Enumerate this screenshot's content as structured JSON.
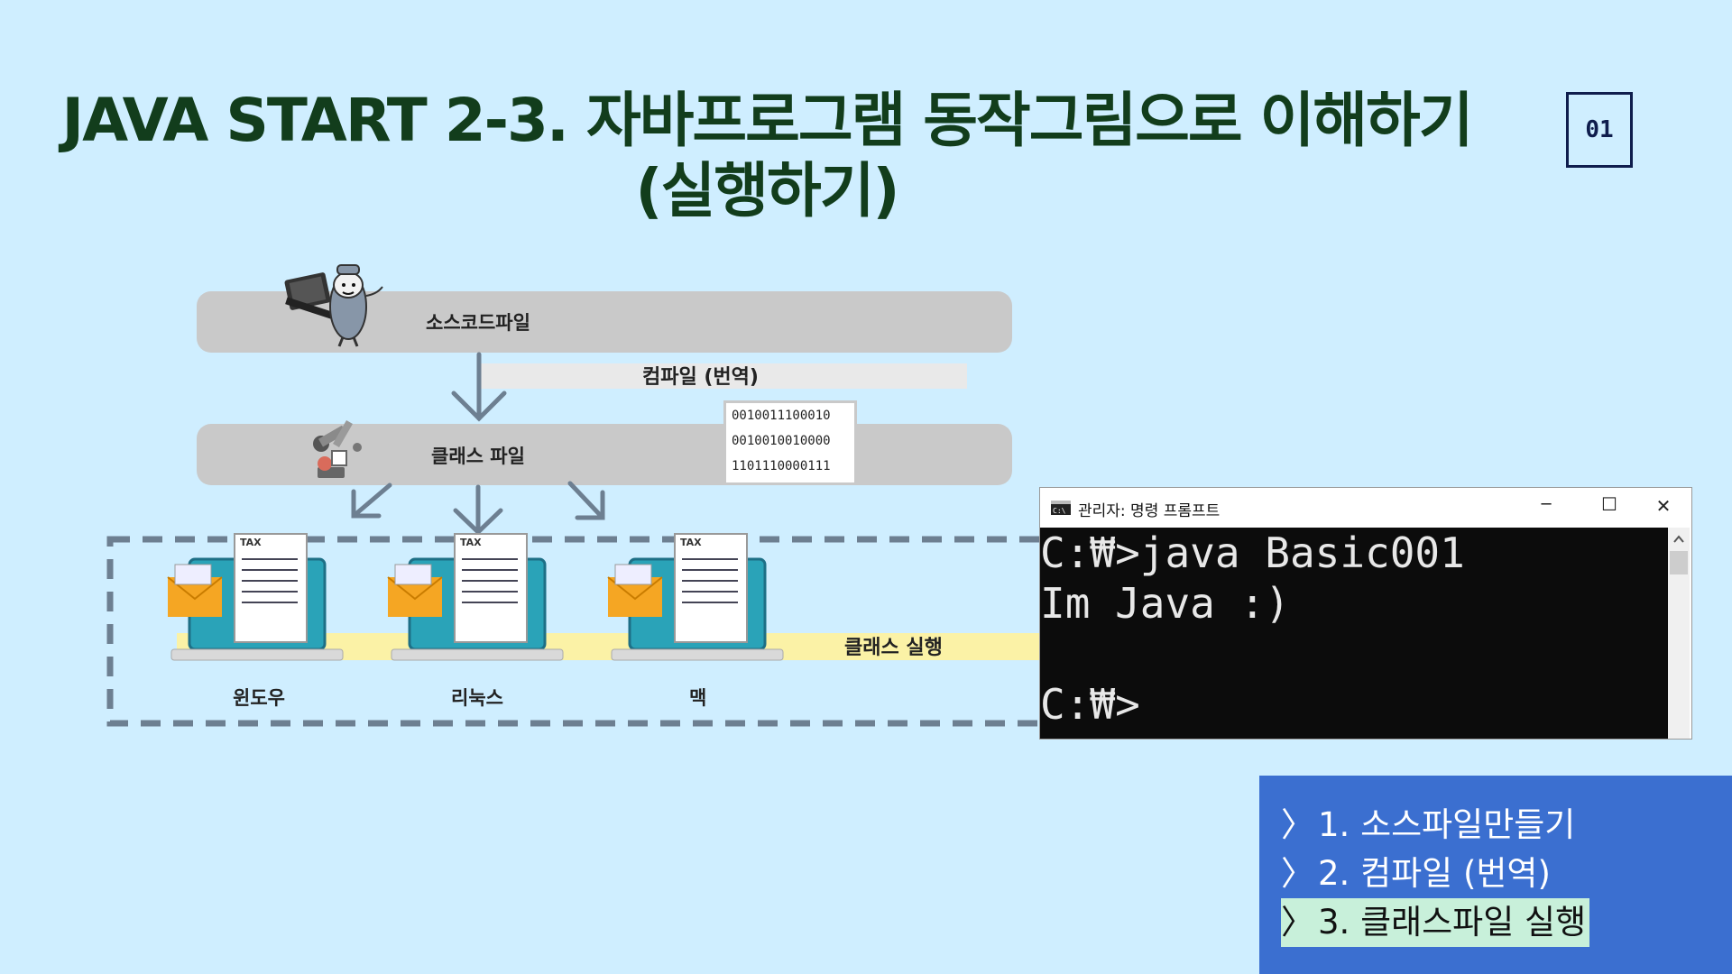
{
  "title": {
    "line1": "JAVA START 2-3. 자바프로그램 동작그림으로 이해하기",
    "line2": "(실행하기)"
  },
  "page_badge": "01",
  "diagram": {
    "source_label": "소스코드파일",
    "compile_label": "컴파일 (번역)",
    "class_label": "클래스 파일",
    "binary_lines": [
      "0010011100010",
      "0010010010000",
      "1101110000111"
    ],
    "run_label": "클래스 실행",
    "os_labels": [
      "윈도우",
      "리눅스",
      "맥"
    ],
    "tax_text": "TAX"
  },
  "cmd": {
    "title": "관리자: 명령 프롬프트",
    "lines": [
      "C:₩>java Basic001",
      "Im Java :)",
      "",
      "C:₩>"
    ],
    "controls": {
      "minimize": "─",
      "maximize": "☐",
      "close": "✕"
    }
  },
  "steps": {
    "chevron": "〉",
    "items": [
      {
        "label": "1. 소스파일만들기",
        "active": false
      },
      {
        "label": "2. 컴파일 (번역)",
        "active": false
      },
      {
        "label": "3.  클래스파일 실행",
        "active": true
      }
    ]
  },
  "colors": {
    "background": "#cfeeff",
    "title": "#123d1c",
    "bar": "#c9c9c9",
    "run_strip": "#fbf2a6",
    "arrow": "#6d7f91",
    "step_panel": "#3b6fd0",
    "step_highlight": "#c8f0da"
  }
}
